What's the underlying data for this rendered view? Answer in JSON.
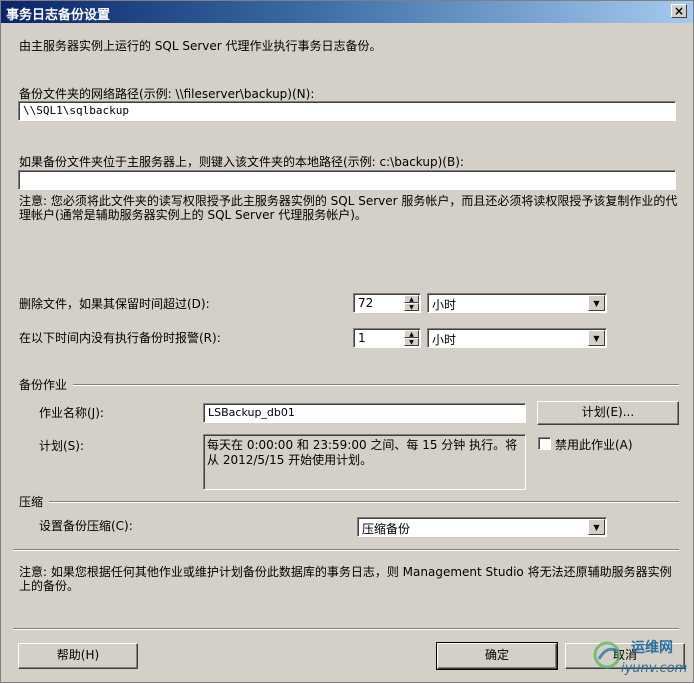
{
  "window": {
    "title": "事务日志备份设置",
    "close_glyph": "×"
  },
  "intro_text": "由主服务器实例上运行的 SQL Server 代理作业执行事务日志备份。",
  "network_path": {
    "label": "备份文件夹的网络路径(示例: \\\\fileserver\\backup)(N):",
    "value": "\\\\SQL1\\sqlbackup"
  },
  "local_path": {
    "label": "如果备份文件夹位于主服务器上，则键入该文件夹的本地路径(示例: c:\\backup)(B):",
    "value": ""
  },
  "permission_note": "注意: 您必须将此文件夹的读写权限授予此主服务器实例的 SQL Server 服务帐户，而且还必须将读权限授予该复制作业的代理帐户(通常是辅助服务器实例上的 SQL Server 代理服务帐户)。",
  "delete_files": {
    "label": "删除文件，如果其保留时间超过(D):",
    "value": "72",
    "unit": "小时"
  },
  "alert": {
    "label": "在以下时间内没有执行备份时报警(R):",
    "value": "1",
    "unit": "小时"
  },
  "backup_job": {
    "section_title": "备份作业",
    "job_name_label": "作业名称(J):",
    "job_name_value": "LSBackup_db01",
    "schedule_button": "计划(E)...",
    "schedule_label": "计划(S):",
    "schedule_text": "每天在 0:00:00 和 23:59:00 之间、每 15 分钟 执行。将从 2012/5/15 开始使用计划。",
    "disable_job_label": "禁用此作业(A)"
  },
  "compression": {
    "section_title": "压缩",
    "label": "设置备份压缩(C):",
    "value": "压缩备份"
  },
  "bottom_note": "注意: 如果您根据任何其他作业或维护计划备份此数据库的事务日志，则 Management Studio 将无法还原辅助服务器实例上的备份。",
  "buttons": {
    "help": "帮助(H)",
    "ok": "确定",
    "cancel": "取消"
  },
  "watermark": {
    "text1": "运维网",
    "text2": "iyunv.com"
  },
  "colors": {
    "titlebar_start": "#0a246a",
    "titlebar_end": "#a6caf0",
    "dialog_bg": "#d4d0c8"
  }
}
